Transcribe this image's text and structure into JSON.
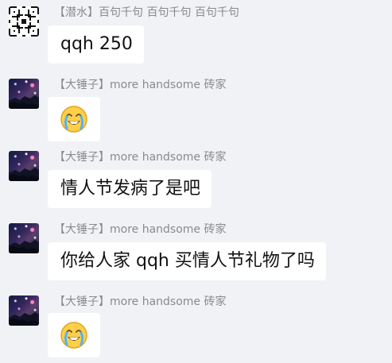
{
  "messages": [
    {
      "sender": "【潜水】百句千句 百句千句 百句千句",
      "avatar_icon": "checkered-pattern-avatar",
      "type": "text",
      "text": "qqh 250"
    },
    {
      "sender": "【大锤子】more handsome 砖家",
      "avatar_icon": "night-sky-avatar",
      "type": "emoji",
      "emoji": "loudly-crying-face"
    },
    {
      "sender": "【大锤子】more handsome 砖家",
      "avatar_icon": "night-sky-avatar",
      "type": "text",
      "text": "情人节发病了是吧"
    },
    {
      "sender": "【大锤子】more handsome 砖家",
      "avatar_icon": "night-sky-avatar",
      "type": "text",
      "text": "你给人家 qqh 买情人节礼物了吗"
    },
    {
      "sender": "【大锤子】more handsome 砖家",
      "avatar_icon": "night-sky-avatar",
      "type": "emoji",
      "emoji": "loudly-crying-face"
    }
  ],
  "colors": {
    "background": "#f1f2f6",
    "bubble": "#ffffff",
    "sender_name": "#8a8a8a",
    "message_text": "#111111"
  }
}
